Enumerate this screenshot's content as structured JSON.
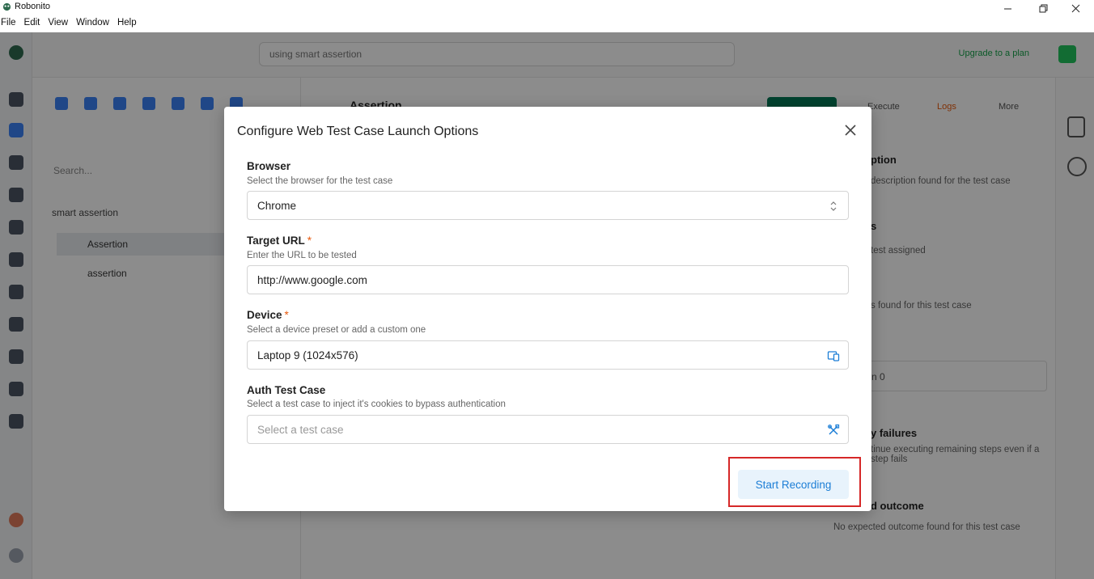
{
  "window": {
    "title": "Robonito",
    "menu": [
      "File",
      "Edit",
      "View",
      "Window",
      "Help"
    ]
  },
  "background": {
    "search_text": "using smart assertion",
    "top_link": "Upgrade to a plan",
    "explorer_search_placeholder": "Search...",
    "folder": "smart assertion",
    "items": [
      "Assertion",
      "assertion"
    ],
    "content_title": "Assertion",
    "tabs": [
      "Execute",
      "Logs",
      "More"
    ],
    "right_panel": {
      "sections": [
        {
          "title": "ption",
          "sub": "description found for the test case"
        },
        {
          "title": "s",
          "sub": "test assigned"
        },
        {
          "title": "",
          "sub": "s found for this test case"
        },
        {
          "title": "y failures",
          "sub": "tinue executing remaining steps even if a step fails"
        },
        {
          "title": "d outcome",
          "sub": "No expected outcome found for this test case"
        }
      ],
      "select_value": "n 0"
    }
  },
  "modal": {
    "title": "Configure Web Test Case Launch Options",
    "browser": {
      "label": "Browser",
      "help": "Select the browser for the test case",
      "value": "Chrome"
    },
    "target_url": {
      "label": "Target URL",
      "required_mark": "*",
      "help": "Enter the URL to be tested",
      "value": "http://www.google.com"
    },
    "device": {
      "label": "Device",
      "required_mark": "*",
      "help": "Select a device preset or add a custom one",
      "value": "Laptop 9 (1024x576)"
    },
    "auth": {
      "label": "Auth Test Case",
      "help": "Select a test case to inject it's cookies to bypass authentication",
      "placeholder": "Select a test case"
    },
    "start_button": "Start Recording"
  },
  "colors": {
    "accent": "#1c7ed6",
    "accent_bg": "#e8f3fc",
    "required": "#e8590c",
    "highlight": "#d62828"
  }
}
